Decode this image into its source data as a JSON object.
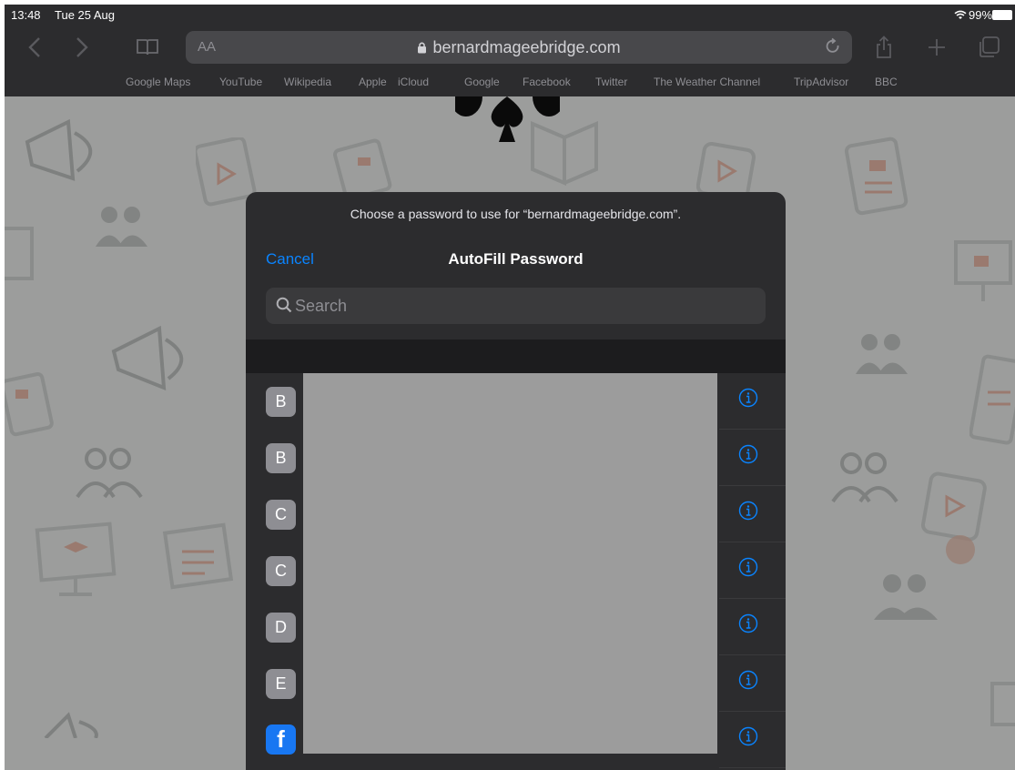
{
  "status_bar": {
    "time": "13:48",
    "date": "Tue 25 Aug",
    "battery": "99%"
  },
  "toolbar": {
    "reader_label": "AA",
    "url": "bernardmageebridge.com"
  },
  "favorites": [
    "Google Maps",
    "YouTube",
    "Wikipedia",
    "Apple",
    "iCloud",
    "Google",
    "Facebook",
    "Twitter",
    "The Weather Channel",
    "TripAdvisor",
    "BBC"
  ],
  "autofill": {
    "subtitle": "Choose a password to use for “bernardmageebridge.com”.",
    "cancel_label": "Cancel",
    "title": "AutoFill Password",
    "search_placeholder": "Search",
    "items": [
      {
        "letter": "B",
        "icon": "letter-avatar"
      },
      {
        "letter": "B",
        "icon": "letter-avatar"
      },
      {
        "letter": "C",
        "icon": "letter-avatar"
      },
      {
        "letter": "C",
        "icon": "letter-avatar"
      },
      {
        "letter": "D",
        "icon": "letter-avatar"
      },
      {
        "letter": "E",
        "icon": "letter-avatar"
      },
      {
        "letter": "f",
        "icon": "facebook-icon"
      }
    ]
  },
  "colors": {
    "accent": "#0a84ff",
    "popover": "#2c2c2e",
    "chrome": "#2c2c2e"
  }
}
